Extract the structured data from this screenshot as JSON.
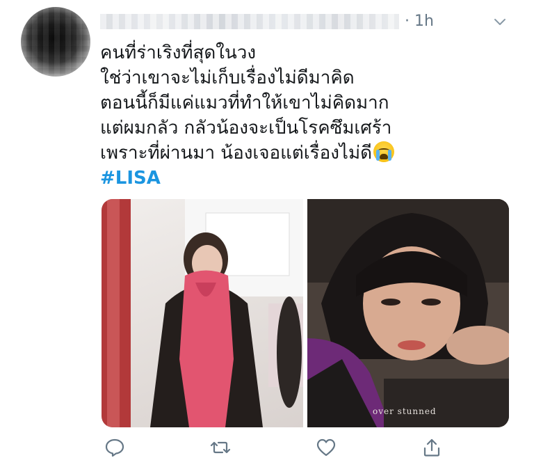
{
  "tweet": {
    "time": "1h",
    "separator": "·",
    "text_lines": [
      "คนที่ร่าเริงที่สุดในวง",
      "ใช่ว่าเขาจะไม่เก็บเรื่องไม่ดีมาคิด",
      "ตอนนี้ก็มีแค่แมวที่ทำให้เขาไม่คิดมาก",
      "แต่ผมกลัว กลัวน้องจะเป็นโรคซึมเศร้า",
      "เพราะที่ผ่านมา น้องเจอแต่เรื่องไม่ดี"
    ],
    "hashtag": "#LISA",
    "emoji": "loudly-crying-face",
    "media": {
      "watermark": "over stunned"
    },
    "actions": [
      {
        "name": "reply-icon"
      },
      {
        "name": "retweet-icon"
      },
      {
        "name": "like-icon"
      },
      {
        "name": "share-icon"
      }
    ]
  },
  "colors": {
    "link": "#1b95e0",
    "muted": "#657786",
    "text": "#14171a"
  }
}
